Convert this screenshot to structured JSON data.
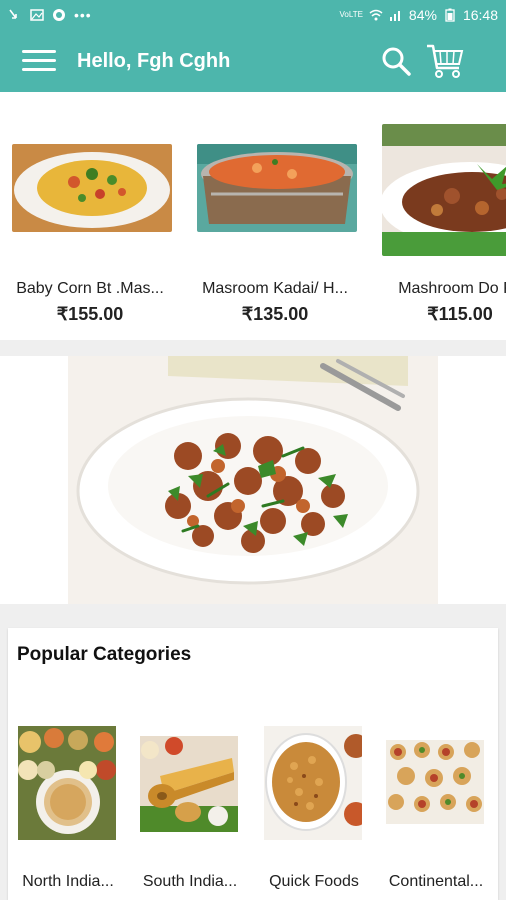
{
  "status_bar": {
    "battery": "84%",
    "time": "16:48",
    "icons": [
      "missed-call-icon",
      "gallery-icon",
      "app-icon",
      "more-icon",
      "volte-icon",
      "wifi-icon",
      "signal-icon",
      "battery-icon"
    ]
  },
  "app_bar": {
    "title": "Hello, Fgh Cghh",
    "icons": [
      "menu-icon",
      "search-icon",
      "cart-icon"
    ],
    "color": "#4db6ac"
  },
  "products": [
    {
      "name": "Baby Corn Bt .Mas...",
      "price": "₹155.00"
    },
    {
      "name": "Masroom Kadai/ H...",
      "price": "₹135.00"
    },
    {
      "name": "Mashroom Do Py",
      "price": "₹115.00"
    }
  ],
  "categories": {
    "title": "Popular Categories",
    "items": [
      {
        "name": "North India..."
      },
      {
        "name": "South India..."
      },
      {
        "name": "Quick Foods"
      },
      {
        "name": "Continental..."
      }
    ]
  }
}
